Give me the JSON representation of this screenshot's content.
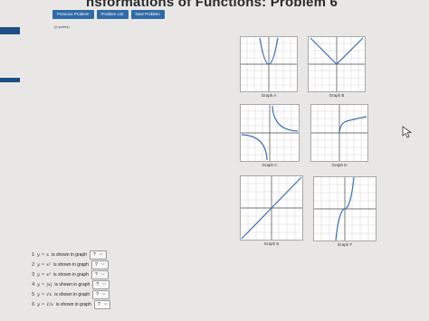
{
  "page": {
    "title": "nsformations of Functions: Problem 6",
    "points": "(6 points)"
  },
  "toolbar": {
    "prev": "Previous Problem",
    "list": "Problem List",
    "next": "Next Problem"
  },
  "colors": {
    "accent": "#2f6aa8",
    "sidebar": "#1d4f86",
    "curve": "#3b6fb5"
  },
  "graphs": [
    {
      "caption": "Graph A"
    },
    {
      "caption": "Graph B"
    },
    {
      "caption": "Graph C"
    },
    {
      "caption": "Graph D"
    },
    {
      "caption": "Graph E"
    },
    {
      "caption": "Graph F"
    }
  ],
  "questions": [
    {
      "num": "1",
      "eq": "y = x",
      "text": "is shown in graph",
      "selected": "?"
    },
    {
      "num": "2",
      "eq": "y = x²",
      "text": "is shown in graph",
      "selected": "?"
    },
    {
      "num": "3",
      "eq": "y = x³",
      "text": "is shown in graph",
      "selected": "?"
    },
    {
      "num": "4",
      "eq": "y = |x|",
      "text": "is shown in graph",
      "selected": "?"
    },
    {
      "num": "5",
      "eq": "y = √x",
      "text": "is shown in graph",
      "selected": "?"
    },
    {
      "num": "6",
      "eq": "y = 1/x",
      "text": "is shown in graph",
      "selected": "?"
    }
  ],
  "icons": {
    "dropdown": "chevron-down-icon",
    "cursor": "mouse-pointer-icon"
  }
}
